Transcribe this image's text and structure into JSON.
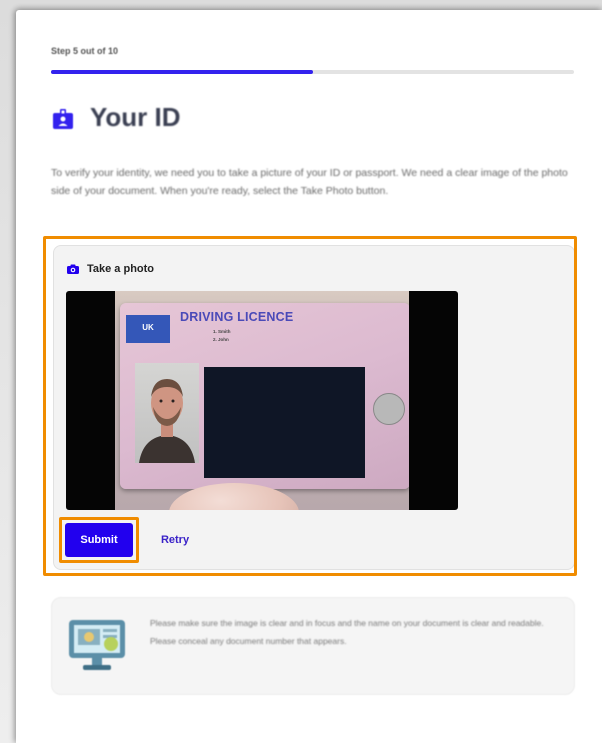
{
  "step": {
    "label": "Step 5 out of 10",
    "progress_fraction": 0.5
  },
  "page": {
    "title": "Your ID",
    "title_icon": "id-badge-icon",
    "intro": "To verify your identity, we need you to take a picture of your ID or passport. We need a clear image of the photo side of your document. When you're ready, select the Take Photo button."
  },
  "capture": {
    "icon": "camera-icon",
    "title": "Take a photo",
    "card_flag_text": "UK",
    "card_heading": "DRIVING LICENCE",
    "card_line_1": "1. Smith",
    "card_line_2": "2. John"
  },
  "actions": {
    "submit_label": "Submit",
    "retry_label": "Retry"
  },
  "tip": {
    "icon": "monitor-icon",
    "text": "Please make sure the image is clear and in focus and the name on your document is clear and readable. Please conceal any document number that appears."
  },
  "colors": {
    "accent": "#2200ee",
    "highlight": "#f08c00",
    "title_text": "#3a3f52"
  }
}
